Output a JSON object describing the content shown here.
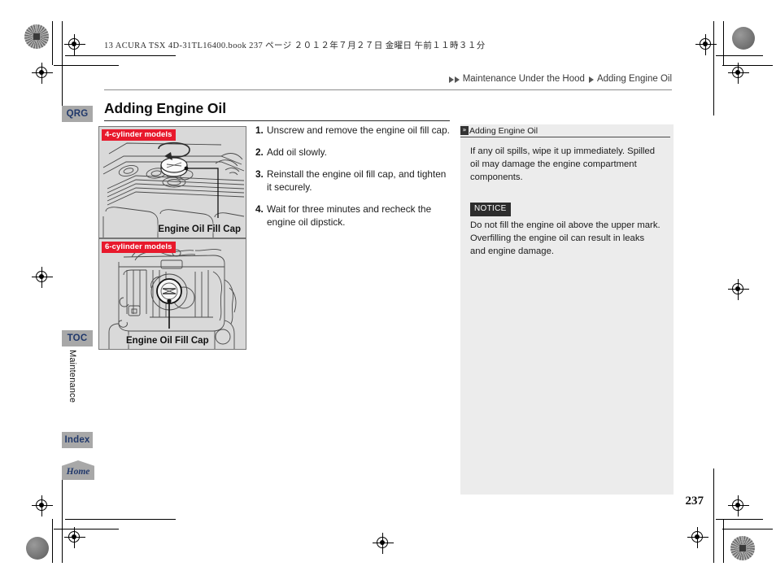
{
  "printmark": {
    "filestamp_parts": [
      "13 ACURA TSX 4D-31TL16400.book",
      "237 ページ",
      "２０１２年７月２７日",
      "金曜日",
      "午前１１時３１分"
    ],
    "filestamp_full": "13 ACURA TSX 4D-31TL16400.book  237 ページ  ２０１２年７月２７日  金曜日  午前１１時３１分"
  },
  "breadcrumb": {
    "marker": "double-triangle",
    "parent": "Maintenance Under the Hood",
    "separator": "triangle",
    "current": "Adding Engine Oil"
  },
  "page": {
    "title": "Adding Engine Oil",
    "number": "237"
  },
  "tabs": {
    "qrg": "QRG",
    "toc": "TOC",
    "section": "Maintenance",
    "index": "Index",
    "home": "Home"
  },
  "steps": [
    {
      "num": "1.",
      "text": "Unscrew and remove the engine oil fill cap."
    },
    {
      "num": "2.",
      "text": "Add oil slowly."
    },
    {
      "num": "3.",
      "text": "Reinstall the engine oil fill cap, and tighten it securely."
    },
    {
      "num": "4.",
      "text": "Wait for three minutes and recheck the engine oil dipstick."
    }
  ],
  "figures": [
    {
      "badge": "4-cylinder models",
      "caption": "Engine Oil Fill Cap"
    },
    {
      "badge": "6-cylinder models",
      "caption": "Engine Oil Fill Cap"
    }
  ],
  "sidepanel": {
    "marker": "»",
    "heading": "Adding Engine Oil",
    "paragraph": "If any oil spills, wipe it up immediately. Spilled oil may damage the engine compartment components.",
    "notice_label": "NOTICE",
    "notice_text": "Do not fill the engine oil above the upper mark. Overfilling the engine oil can result in leaks and engine damage."
  },
  "colors": {
    "badge_red": "#e8192c",
    "tab_gray": "#a8a8a8",
    "tab_text_blue": "#20386b",
    "panel_gray": "#ececec",
    "figure_gray": "#d9d9d9"
  }
}
